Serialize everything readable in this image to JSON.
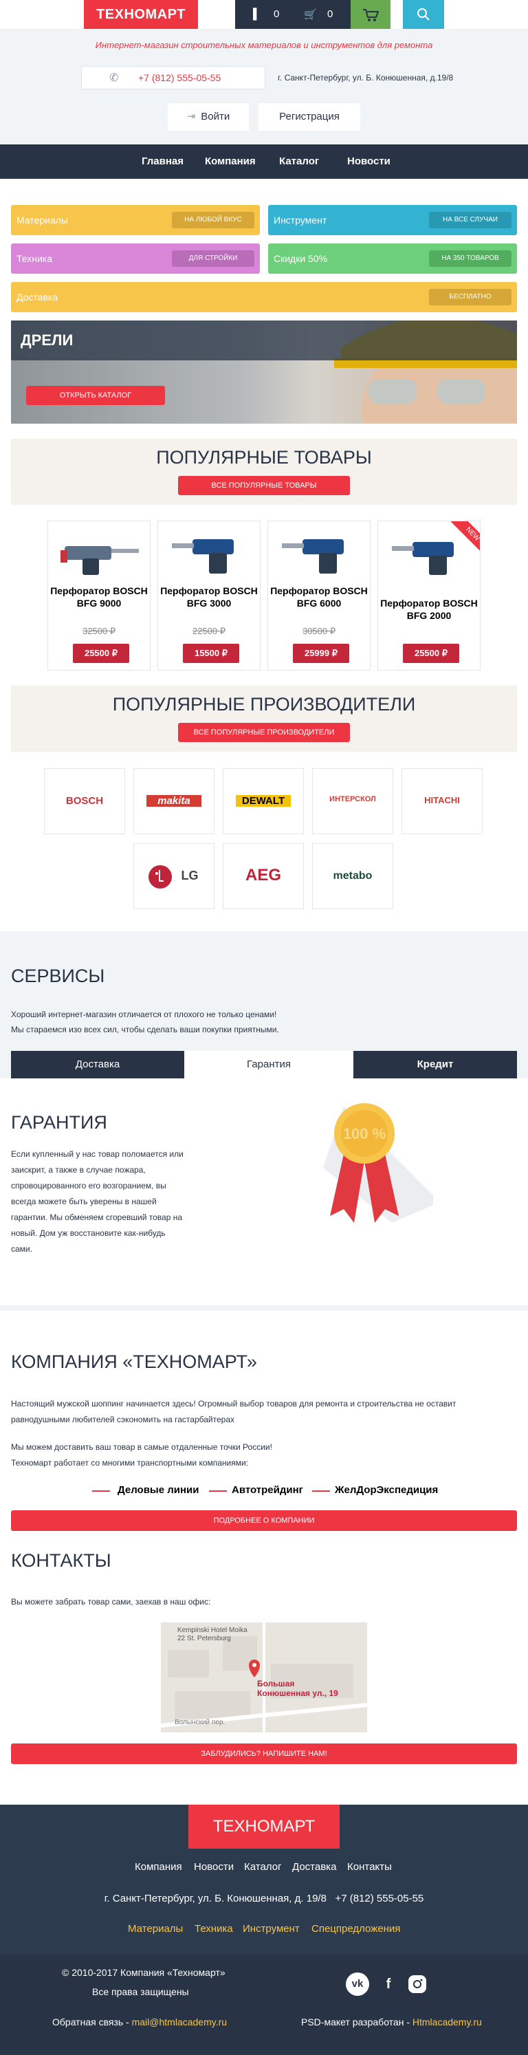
{
  "header": {
    "logo": "ТЕХНОМАРТ",
    "fav_count": "0",
    "cart_count": "0",
    "tagline": "Интернет-магазин строительных материалов и инструментов для ремонта",
    "phone": "+7 (812) 555-05-55",
    "address": "г. Санкт-Петербург, ул. Б. Конюшенная, д.19/8",
    "login": "Войти",
    "register": "Регистрация"
  },
  "nav": [
    "Главная",
    "Компания",
    "Каталог",
    "Новости"
  ],
  "categories": [
    {
      "label": "Материалы",
      "badge": "НА ЛЮБОЙ ВКУС"
    },
    {
      "label": "Инструмент",
      "badge": "НА ВСЕ СЛУЧАИ"
    },
    {
      "label": "Техника",
      "badge": "ДЛЯ СТРОЙКИ"
    },
    {
      "label": "Скидки 50%",
      "badge": "НА 350 ТОВАРОВ"
    },
    {
      "label": "Доставка",
      "badge": "БЕСПЛАТНО"
    }
  ],
  "hero": {
    "title": "ДРЕЛИ",
    "button": "ОТКРЫТЬ КАТАЛОГ"
  },
  "popular": {
    "title": "ПОПУЛЯРНЫЕ ТОВАРЫ",
    "button": "ВСЕ ПОПУЛЯРНЫЕ ТОВАРЫ",
    "products": [
      {
        "name": "Перфоратор BOSCH BFG 9000",
        "old_price": "32500 ₽",
        "price": "25500 ₽",
        "badge": ""
      },
      {
        "name": "Перфоратор BOSCH BFG 3000",
        "old_price": "22500 ₽",
        "price": "15500 ₽",
        "badge": ""
      },
      {
        "name": "Перфоратор BOSCH BFG 6000",
        "old_price": "30500 ₽",
        "price": "25999 ₽",
        "badge": ""
      },
      {
        "name": "Перфоратор BOSCH BFG 2000",
        "old_price": "",
        "price": "25500 ₽",
        "badge": "NEW"
      }
    ]
  },
  "brands": {
    "title": "ПОПУЛЯРНЫЕ ПРОИЗВОДИТЕЛИ",
    "button": "ВСЕ ПОПУЛЯРНЫЕ ПРОИЗВОДИТЕЛИ",
    "items": [
      "BOSCH",
      "makita",
      "DEWALT",
      "ИНТЕРСКОЛ",
      "HITACHI",
      "LG",
      "AEG",
      "metabo"
    ]
  },
  "services": {
    "title": "СЕРВИСЫ",
    "text1": "Хороший интернет-магазин отличается от плохого не только ценами!",
    "text2": "Мы стараемся изо всех сил, чтобы сделать ваши покупки приятными.",
    "tabs": [
      "Доставка",
      "Гарантия",
      "Кредит"
    ],
    "guarantee_title": "ГАРАНТИЯ",
    "guarantee_lines": [
      "Если купленный у нас товар поломается или",
      "заискрит, а также в случае пожара,",
      "спровоцированного его возгоранием, вы",
      "всегда можете быть уверены в нашей",
      "гарантии. Мы обменяем сгоревший товар на",
      "новый. Дом уж восстановите как-нибудь",
      "сами."
    ],
    "medal_text": "100 %"
  },
  "company": {
    "title": "КОМПАНИЯ «ТЕХНОМАРТ»",
    "p1a": "Настоящий мужской шоппинг начинается здесь! Огромный выбор товаров для ремонта и строительства не оставит",
    "p1b": "равнодушными любителей сэкономить на гастарбайтерах",
    "p2a": "Мы можем доставить ваш товар в самые отдаленные точки России!",
    "p2b": "Техномарт работает со многими транспортными компаниями:",
    "partners": [
      "Деловые линии",
      "Автотрейдинг",
      "ЖелДорЭкспедиция"
    ],
    "button": "ПОДРОБНЕЕ О КОМПАНИИ"
  },
  "contacts": {
    "title": "КОНТАКТЫ",
    "text": "Вы можете забрать товар сами, заехав в наш офис:",
    "map_label1": "Kempinski Hotel Moika",
    "map_label2": "22 St. Petersburg",
    "map_pin1": "Большая",
    "map_pin2": "Конюшенная ул., 19",
    "map_street": "Волынский пер.",
    "button": "ЗАБЛУДИЛИСЬ? НАПИШИТЕ НАМ!"
  },
  "footer": {
    "logo": "ТЕХНОМАРТ",
    "nav": [
      "Компания",
      "Новости",
      "Каталог",
      "Доставка",
      "Контакты"
    ],
    "address": "г. Санкт-Петербург, ул. Б. Конюшенная, д. 19/8",
    "phone": "+7 (812) 555-05-55",
    "categories": [
      "Материалы",
      "Техника",
      "Инструмент",
      "Спецпредложения"
    ],
    "copyright": "© 2010-2017 Компания «Техномарт»",
    "rights": "Все права защищены",
    "feedback_label": "Обратная связь -",
    "feedback_email": "mail@htmlacademy.ru",
    "psd_label": "PSD-макет разработан -",
    "psd_link": "Htmlacademy.ru",
    "social": [
      "vk",
      "f",
      "inst"
    ]
  }
}
